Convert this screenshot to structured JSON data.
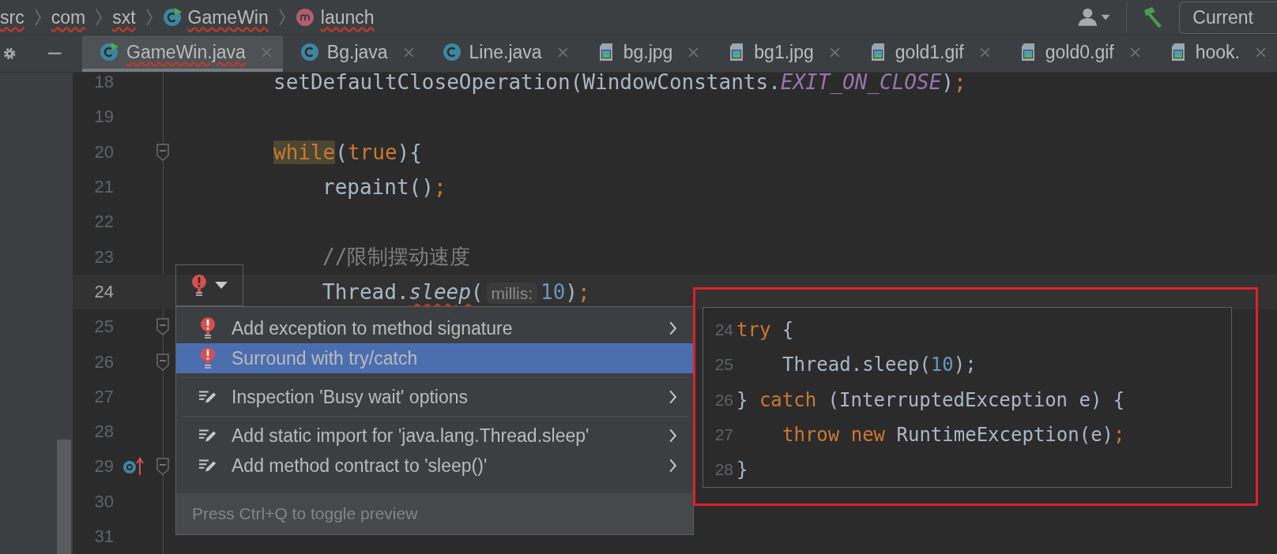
{
  "breadcrumbs": [
    {
      "label": "src",
      "kind": "package",
      "error": true
    },
    {
      "label": "com",
      "kind": "package",
      "error": true
    },
    {
      "label": "sxt",
      "kind": "package",
      "error": true
    },
    {
      "label": "GameWin",
      "kind": "class",
      "error": true
    },
    {
      "label": "launch",
      "kind": "method",
      "error": true
    }
  ],
  "run_configuration": {
    "label": "Current"
  },
  "tabs": [
    {
      "label": "GameWin.java",
      "kind": "class",
      "runnable": true,
      "error": true,
      "selected": true
    },
    {
      "label": "Bg.java",
      "kind": "class",
      "runnable": false,
      "error": false,
      "selected": false
    },
    {
      "label": "Line.java",
      "kind": "class",
      "runnable": false,
      "error": false,
      "selected": false
    },
    {
      "label": "bg.jpg",
      "kind": "image",
      "error": false,
      "selected": false
    },
    {
      "label": "bg1.jpg",
      "kind": "image",
      "error": false,
      "selected": false
    },
    {
      "label": "gold1.gif",
      "kind": "image",
      "error": false,
      "selected": false
    },
    {
      "label": "gold0.gif",
      "kind": "image",
      "error": false,
      "selected": false
    },
    {
      "label": "hook.",
      "kind": "image",
      "error": false,
      "selected": false
    }
  ],
  "editor": {
    "lines": [
      {
        "number": "18",
        "kind": "outer",
        "current": false,
        "fold": false,
        "override": false,
        "parts": [
          {
            "kind": "code",
            "tokens": [
              {
                "text": "setDefaultCloseOperation(WindowConstants.",
                "kind": "plain"
              },
              {
                "text": "EXIT_ON_CLOSE",
                "kind": "constant"
              },
              {
                "text": ")",
                "kind": "plain"
              },
              {
                "text": ";",
                "kind": "keyword"
              }
            ]
          }
        ]
      },
      {
        "number": "19",
        "kind": "outer",
        "current": false,
        "fold": false,
        "override": false
      },
      {
        "number": "20",
        "kind": "outer",
        "current": false,
        "fold": true,
        "override": false,
        "parts": [
          {
            "kind": "code",
            "tokens": [
              {
                "text": "while",
                "kind": "keyword_marked"
              },
              {
                "text": "(",
                "kind": "plain"
              },
              {
                "text": "true",
                "kind": "keyword"
              },
              {
                "text": "){",
                "kind": "plain"
              }
            ]
          }
        ]
      },
      {
        "number": "21",
        "kind": "inner",
        "current": false,
        "fold": false,
        "override": false,
        "parts": [
          {
            "kind": "code",
            "tokens": [
              {
                "text": "repaint()",
                "kind": "plain"
              },
              {
                "text": ";",
                "kind": "keyword"
              }
            ]
          }
        ]
      },
      {
        "number": "22",
        "kind": "inner",
        "current": false,
        "fold": false,
        "override": false
      },
      {
        "number": "23",
        "kind": "inner",
        "current": false,
        "fold": false,
        "override": false,
        "parts": [
          {
            "kind": "code",
            "tokens": [
              {
                "text": "//限制摆动速度",
                "kind": "comment"
              }
            ]
          }
        ]
      },
      {
        "number": "24",
        "kind": "inner",
        "current": true,
        "fold": false,
        "override": false,
        "parts": [
          {
            "kind": "code",
            "tokens": [
              {
                "text": "Thread.",
                "kind": "plain"
              },
              {
                "text": "sleep",
                "kind": "method_error"
              },
              {
                "text": "(",
                "kind": "plain"
              }
            ]
          },
          {
            "kind": "hint",
            "text": "millis:"
          },
          {
            "kind": "code",
            "tokens": [
              {
                "text": "10",
                "kind": "number"
              },
              {
                "text": ")",
                "kind": "plain"
              },
              {
                "text": ";",
                "kind": "keyword"
              }
            ]
          }
        ]
      },
      {
        "number": "25",
        "kind": "inner",
        "current": false,
        "fold": true,
        "override": false
      },
      {
        "number": "26",
        "kind": "inner",
        "current": false,
        "fold": true,
        "override": false
      },
      {
        "number": "27",
        "kind": "inner",
        "current": false,
        "fold": false,
        "override": false
      },
      {
        "number": "28",
        "kind": "inner",
        "current": false,
        "fold": false,
        "override": false
      },
      {
        "number": "29",
        "kind": "inner",
        "current": false,
        "fold": true,
        "override": true
      },
      {
        "number": "30",
        "kind": "inner",
        "current": false,
        "fold": false,
        "override": false
      },
      {
        "number": "31",
        "kind": "inner",
        "current": false,
        "fold": false,
        "override": false
      }
    ]
  },
  "intention_menu": {
    "groups": [
      [
        {
          "label": "Add exception to method signature",
          "kind": "error",
          "submenu": true,
          "selected": false
        },
        {
          "label": "Surround with try/catch",
          "kind": "error",
          "submenu": false,
          "selected": true
        }
      ],
      [
        {
          "label": "Inspection 'Busy wait' options",
          "kind": "edit",
          "submenu": true,
          "selected": false
        }
      ],
      [
        {
          "label": "Add static import for 'java.lang.Thread.sleep'",
          "kind": "edit",
          "submenu": true,
          "selected": false
        },
        {
          "label": "Add method contract to 'sleep()'",
          "kind": "edit",
          "submenu": true,
          "selected": false
        }
      ]
    ],
    "footer": "Press Ctrl+Q to toggle preview"
  },
  "preview": {
    "lines": [
      {
        "number": "24",
        "kind": "outer",
        "tokens": [
          {
            "text": "try",
            "kind": "keyword"
          },
          {
            "text": " {",
            "kind": "plain"
          }
        ]
      },
      {
        "number": "25",
        "kind": "inner",
        "tokens": [
          {
            "text": "Thread.sleep(",
            "kind": "plain"
          },
          {
            "text": "10",
            "kind": "number"
          },
          {
            "text": ");",
            "kind": "plain"
          }
        ]
      },
      {
        "number": "26",
        "kind": "outer",
        "tokens": [
          {
            "text": "} ",
            "kind": "plain"
          },
          {
            "text": "catch",
            "kind": "keyword"
          },
          {
            "text": " (InterruptedException e) {",
            "kind": "plain"
          }
        ]
      },
      {
        "number": "27",
        "kind": "inner",
        "tokens": [
          {
            "text": "throw new",
            "kind": "keyword"
          },
          {
            "text": " RuntimeException(e)",
            "kind": "plain"
          },
          {
            "text": ";",
            "kind": "keyword"
          }
        ]
      },
      {
        "number": "28",
        "kind": "outer",
        "tokens": [
          {
            "text": "}",
            "kind": "plain"
          }
        ]
      }
    ]
  }
}
